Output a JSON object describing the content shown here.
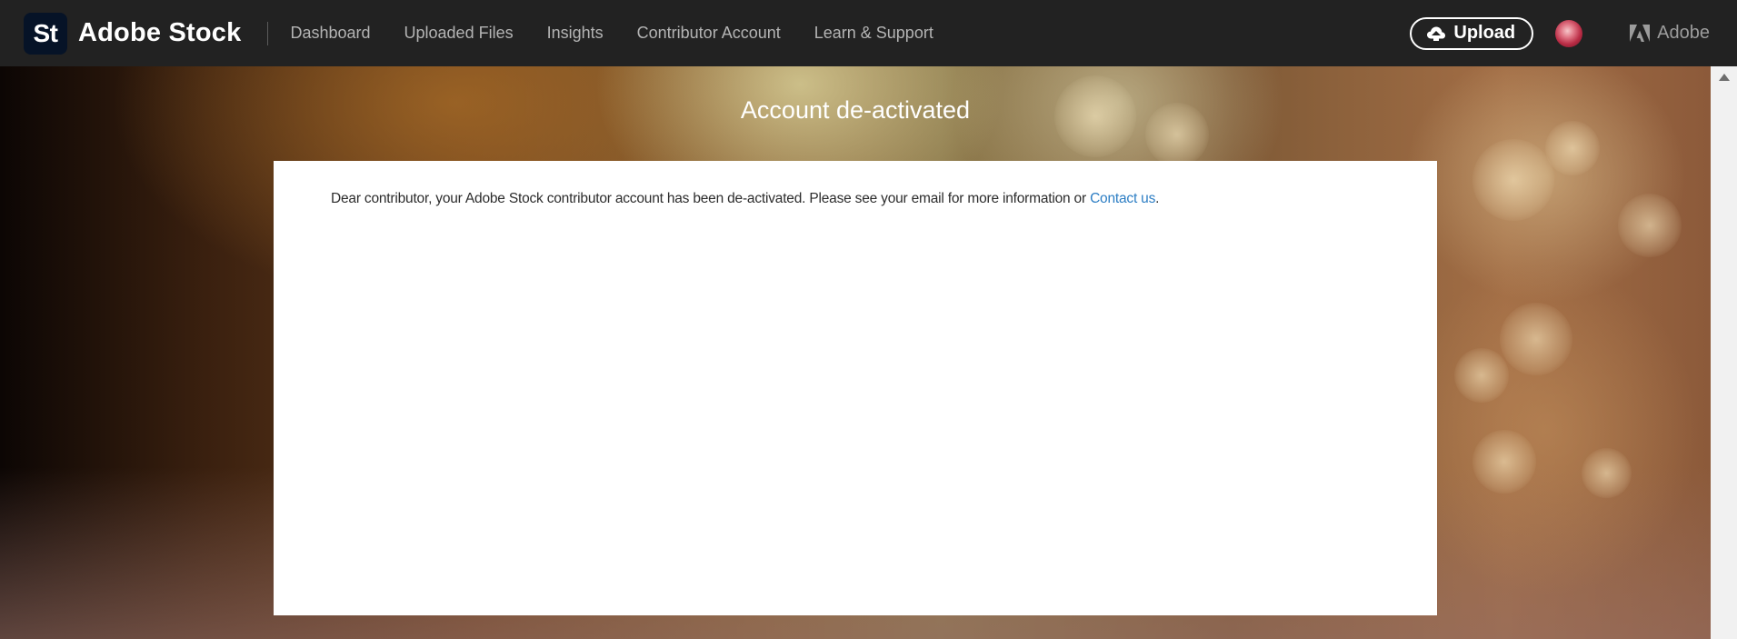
{
  "header": {
    "logo_text": "St",
    "brand_name": "Adobe Stock",
    "nav": [
      {
        "label": "Dashboard"
      },
      {
        "label": "Uploaded Files"
      },
      {
        "label": "Insights"
      },
      {
        "label": "Contributor Account"
      },
      {
        "label": "Learn & Support"
      }
    ],
    "upload_label": "Upload",
    "adobe_label": "Adobe"
  },
  "main": {
    "title": "Account de-activated",
    "message": "Dear contributor, your Adobe Stock contributor account has been de-activated. Please see your email for more information or ",
    "contact_link": "Contact us",
    "message_end": "."
  },
  "icons": {
    "upload": "cloud-upload-icon",
    "adobe": "adobe-logo-icon",
    "scroll": "scroll-up-arrow-icon"
  },
  "colors": {
    "topbar": "#222222",
    "logo_bg": "#061327",
    "link": "#2d7ec4",
    "card": "#ffffff"
  }
}
